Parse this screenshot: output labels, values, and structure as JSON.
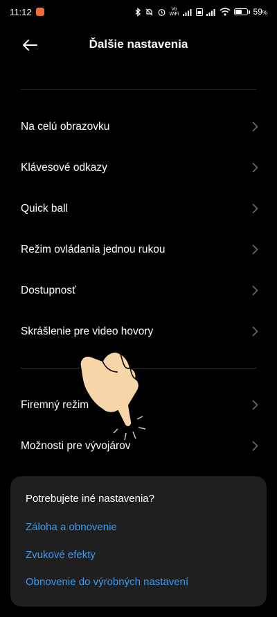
{
  "status_bar": {
    "time": "11:12",
    "network_label_top": "Vo",
    "network_label_bottom": "WiFi",
    "battery_text": "59",
    "battery_unit": "%",
    "battery_level": 0.59
  },
  "header": {
    "title": "Ďalšie nastavenia"
  },
  "menu": {
    "group1": [
      {
        "label": "Na celú obrazovku"
      },
      {
        "label": "Klávesové odkazy"
      },
      {
        "label": "Quick ball"
      },
      {
        "label": "Režim ovládania jednou rukou"
      },
      {
        "label": "Dostupnosť"
      },
      {
        "label": "Skrášlenie pre video hovory"
      }
    ],
    "group2": [
      {
        "label": "Firemný režim"
      },
      {
        "label": "Možnosti pre vývojárov"
      }
    ]
  },
  "card": {
    "title": "Potrebujete iné nastavenia?",
    "links": [
      {
        "label": "Záloha a obnovenie"
      },
      {
        "label": "Zvukové efekty"
      },
      {
        "label": "Obnovenie do výrobných nastavení"
      }
    ]
  },
  "colors": {
    "background": "#000000",
    "link": "#3b9cf5",
    "card": "#1f1f1f",
    "chevron": "#6a6a6a"
  }
}
